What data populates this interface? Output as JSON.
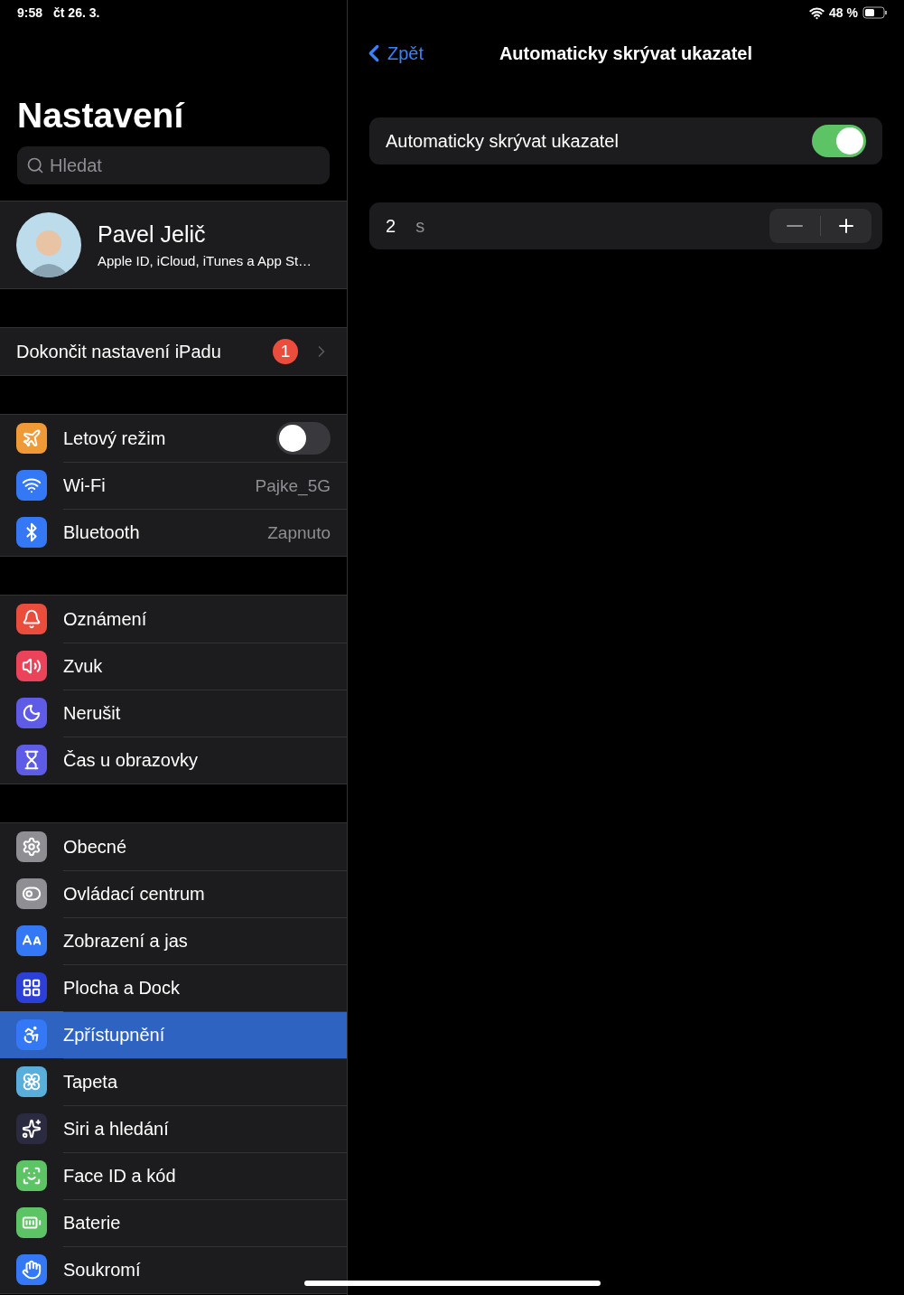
{
  "status_bar": {
    "time": "9:58",
    "date": "čt 26. 3.",
    "battery": "48 %"
  },
  "sidebar": {
    "title": "Nastavení",
    "search": {
      "placeholder": "Hledat"
    },
    "profile": {
      "name": "Pavel Jelič",
      "subtitle": "Apple ID, iCloud, iTunes a App St…"
    },
    "setup": {
      "label": "Dokončit nastavení iPadu",
      "badge": "1"
    },
    "groups": [
      [
        {
          "label": "Letový režim",
          "kind": "toggle",
          "on": false,
          "color": "#f09a37",
          "selected": false
        },
        {
          "label": "Wi-Fi",
          "kind": "value",
          "value": "Pajke_5G",
          "color": "#3478f6",
          "selected": false
        },
        {
          "label": "Bluetooth",
          "kind": "value",
          "value": "Zapnuto",
          "color": "#3478f6",
          "selected": false
        }
      ],
      [
        {
          "label": "Oznámení",
          "kind": "plain",
          "color": "#eb4d3d",
          "selected": false
        },
        {
          "label": "Zvuk",
          "kind": "plain",
          "color": "#eb445a",
          "selected": false
        },
        {
          "label": "Nerušit",
          "kind": "plain",
          "color": "#5e5ce6",
          "selected": false
        },
        {
          "label": "Čas u obrazovky",
          "kind": "plain",
          "color": "#5e5ce6",
          "selected": false
        }
      ],
      [
        {
          "label": "Obecné",
          "kind": "plain",
          "color": "#8e8e93",
          "selected": false
        },
        {
          "label": "Ovládací centrum",
          "kind": "plain",
          "color": "#8e8e93",
          "selected": false
        },
        {
          "label": "Zobrazení a jas",
          "kind": "plain",
          "color": "#3478f6",
          "selected": false
        },
        {
          "label": "Plocha a Dock",
          "kind": "plain",
          "color": "#2c3fd6",
          "selected": false
        },
        {
          "label": "Zpřístupnění",
          "kind": "plain",
          "color": "#3478f6",
          "selected": true
        },
        {
          "label": "Tapeta",
          "kind": "plain",
          "color": "#5aaedc",
          "selected": false
        },
        {
          "label": "Siri a hledání",
          "kind": "plain",
          "color": "#2a2a40",
          "selected": false
        },
        {
          "label": "Face ID a kód",
          "kind": "plain",
          "color": "#5dc466",
          "selected": false
        },
        {
          "label": "Baterie",
          "kind": "plain",
          "color": "#5dc466",
          "selected": false
        },
        {
          "label": "Soukromí",
          "kind": "plain",
          "color": "#3478f6",
          "selected": false
        }
      ]
    ]
  },
  "detail": {
    "back": "Zpět",
    "title": "Automaticky skrývat ukazatel",
    "toggle": {
      "label": "Automaticky skrývat ukazatel",
      "on": true
    },
    "stepper": {
      "value": "2",
      "unit": "s"
    }
  }
}
